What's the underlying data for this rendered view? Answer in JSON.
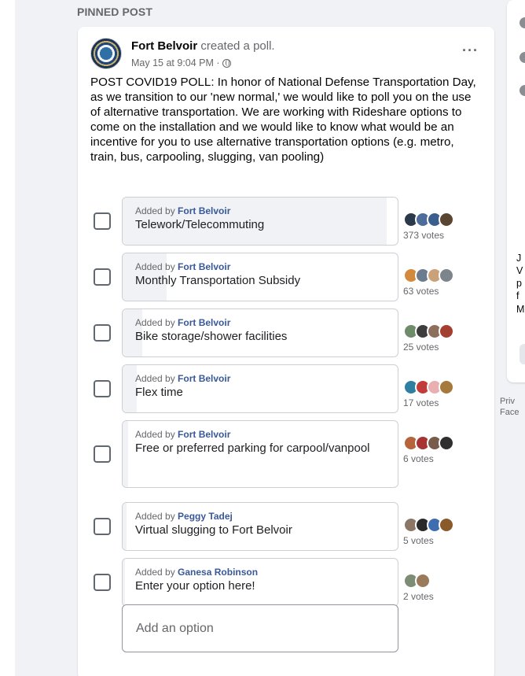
{
  "section": {
    "label": "PINNED POST"
  },
  "post": {
    "author": "Fort Belvoir",
    "action": " created a poll.",
    "timestamp": "May 15 at 9:04 PM ·",
    "more_label": "···",
    "text": "POST COVID19 POLL: In honor of National Defense Transportation Day, as we transition to our 'new normal,' we would like to poll you on the use of alternative transportation.  We are working with Rideshare options to come on the installation and we would like to know what would be an incentive for you to use alternative transportation options (e.g. metro, train, bus, carpooling, slugging, van pooling)"
  },
  "poll": {
    "added_by_prefix": "Added by ",
    "options": [
      {
        "added_by": "Fort Belvoir",
        "label": "Telework/Telecommuting",
        "votes": "373 votes",
        "share": 0.96,
        "voter_colors": [
          "#2b3a4a",
          "#4d6d9a",
          "#3a5f8f",
          "#5a4630"
        ]
      },
      {
        "added_by": "Fort Belvoir",
        "label": "Monthly Transportation Subsidy",
        "votes": "63 votes",
        "share": 0.16,
        "voter_colors": [
          "#d48a3c",
          "#6b7c8e",
          "#c9a27a",
          "#7d858c"
        ]
      },
      {
        "added_by": "Fort Belvoir",
        "label": "Bike storage/shower facilities",
        "votes": "25 votes",
        "share": 0.07,
        "voter_colors": [
          "#6f8c6a",
          "#3d3d3d",
          "#8e6f5c",
          "#a33f2f"
        ]
      },
      {
        "added_by": "Fort Belvoir",
        "label": "Flex time",
        "votes": "17 votes",
        "share": 0.05,
        "voter_colors": [
          "#2e7fa0",
          "#c23c3c",
          "#e8b0b0",
          "#a57a3a"
        ]
      },
      {
        "added_by": "Fort Belvoir",
        "label": "Free or preferred parking for carpool/vanpool",
        "votes": "6 votes",
        "share": 0.02,
        "voter_colors": [
          "#b5643c",
          "#a93232",
          "#7a5c4a",
          "#2f2f2f"
        ]
      },
      {
        "added_by": "Peggy Tadej",
        "label": "Virtual slugging to Fort Belvoir",
        "votes": "5 votes",
        "share": 0.015,
        "voter_colors": [
          "#8c7766",
          "#2a2a2a",
          "#3e6db0",
          "#8a5a2a"
        ]
      },
      {
        "added_by": "Ganesa Robinson",
        "label": "Enter your option here!",
        "votes": "2 votes",
        "share": 0.005,
        "voter_colors": [
          "#7d8c74",
          "#9a7a5a"
        ]
      }
    ],
    "add_option_placeholder": "Add an option"
  },
  "right": {
    "fragments": [
      "J",
      "V",
      "p",
      "f",
      "M"
    ],
    "footer": [
      "Priv",
      "Face"
    ]
  },
  "colors": {
    "link": "#385898",
    "bar_fill": "#f0f2f5",
    "page_bg": "#f0f2f5"
  }
}
